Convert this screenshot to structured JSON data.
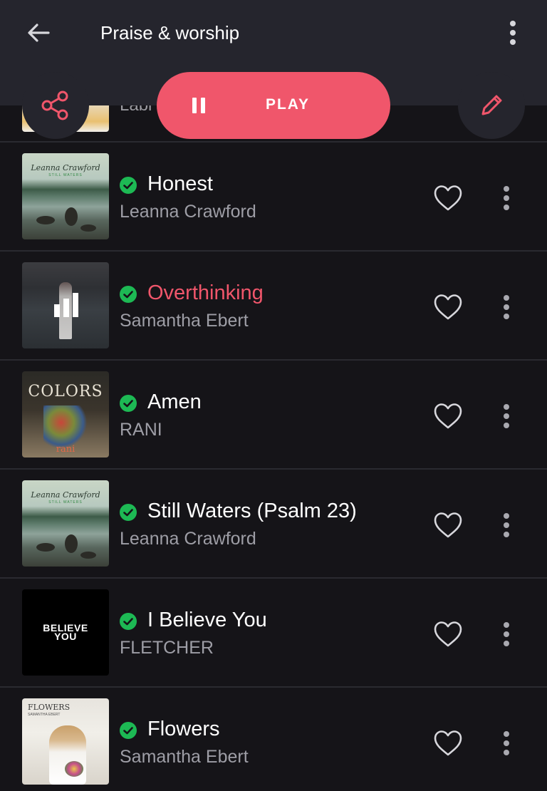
{
  "header": {
    "title": "Praise & worship"
  },
  "actions": {
    "play_label": "PLAY"
  },
  "peek_row": {
    "label_partial": "Labi"
  },
  "tracks": [
    {
      "title": "Honest",
      "artist": "Leanna Crawford",
      "art_title": "Leanna Crawford",
      "art_sub": "STILL WATERS",
      "playing": false
    },
    {
      "title": "Overthinking",
      "artist": "Samantha Ebert",
      "playing": true
    },
    {
      "title": "Amen",
      "artist": "RANI",
      "art_title": "COLORS",
      "art_name": "rani",
      "playing": false
    },
    {
      "title": "Still Waters (Psalm 23)",
      "artist": "Leanna Crawford",
      "art_title": "Leanna Crawford",
      "art_sub": "STILL WATERS",
      "playing": false
    },
    {
      "title": "I Believe You",
      "artist": "FLETCHER",
      "art_text_1": "BELIEVE",
      "art_text_2": "YOU",
      "playing": false
    },
    {
      "title": "Flowers",
      "artist": "Samantha Ebert",
      "art_title": "FLOWERS",
      "art_sub": "SAMANTHA EBERT",
      "playing": false
    }
  ],
  "colors": {
    "accent": "#f0566b",
    "downloaded": "#1db954",
    "appbar": "#25252d",
    "background": "#151418"
  },
  "icons": {
    "back": "arrow-left-icon",
    "overflow": "more-vert-icon",
    "share": "share-icon",
    "edit": "pencil-icon",
    "pause": "pause-icon",
    "downloaded": "check-circle-icon",
    "like": "heart-outline-icon",
    "equalizer": "equalizer-icon"
  }
}
